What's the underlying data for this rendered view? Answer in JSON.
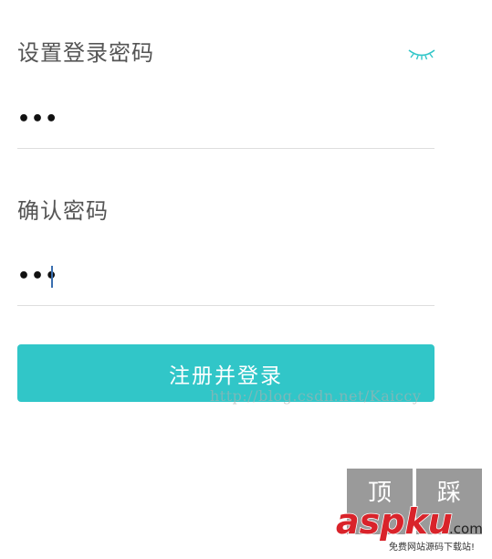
{
  "form": {
    "password": {
      "label": "设置登录密码",
      "value": "•••",
      "toggle_icon": "closed-eye-icon"
    },
    "confirm": {
      "label": "确认密码",
      "value": "•••"
    },
    "submit_label": "注册并登录"
  },
  "watermark": {
    "url": "http://blog.csdn.net/Kaiccy"
  },
  "vote": {
    "up_label": "顶",
    "down_label": "踩"
  },
  "logo": {
    "text": "aspku.com",
    "tagline": "免费网站源码下载站!"
  },
  "colors": {
    "accent": "#31c6c8",
    "caret": "#3a6fb0",
    "logo_red": "#d9232a"
  }
}
